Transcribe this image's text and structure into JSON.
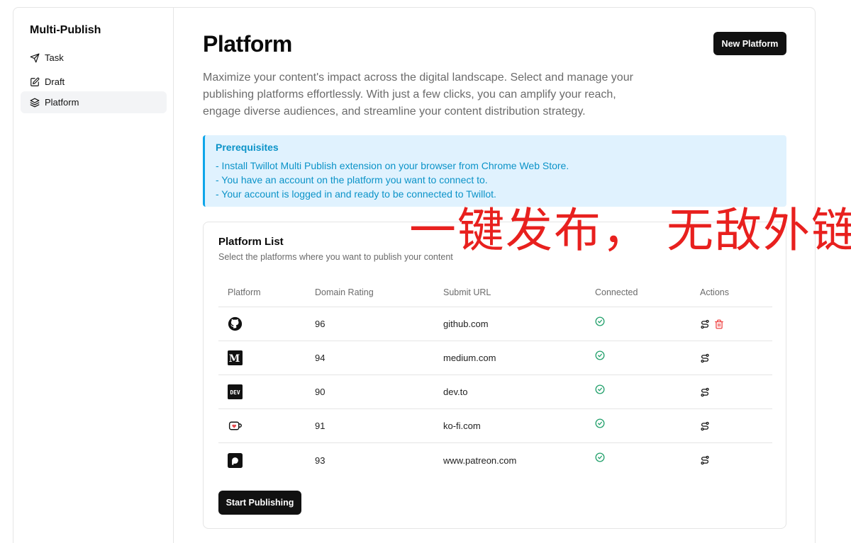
{
  "sidebar": {
    "app_title": "Multi-Publish",
    "items": [
      {
        "label": "Task",
        "icon": "send-icon"
      },
      {
        "label": "Draft",
        "icon": "edit-icon"
      },
      {
        "label": "Platform",
        "icon": "layers-icon",
        "active": true
      }
    ]
  },
  "header": {
    "title": "Platform",
    "new_button": "New Platform",
    "description": "Maximize your content's impact across the digital landscape. Select and manage your publishing platforms effortlessly. With just a few clicks, you can amplify your reach, engage diverse audiences, and streamline your content distribution strategy."
  },
  "prerequisites": {
    "title": "Prerequisites",
    "items": [
      "- Install Twillot Multi Publish extension on your browser from Chrome Web Store.",
      "- You have an account on the platform you want to connect to.",
      "- Your account is logged in and ready to be connected to Twillot."
    ]
  },
  "platform_list": {
    "title": "Platform List",
    "subtitle": "Select the platforms where you want to publish your content",
    "columns": [
      "Platform",
      "Domain Rating",
      "Submit URL",
      "Connected",
      "Actions"
    ],
    "rows": [
      {
        "icon": "github-icon",
        "rating": "96",
        "url": "github.com",
        "connected": true,
        "deletable": true
      },
      {
        "icon": "medium-icon",
        "rating": "94",
        "url": "medium.com",
        "connected": true,
        "deletable": false
      },
      {
        "icon": "dev-icon",
        "rating": "90",
        "url": "dev.to",
        "connected": true,
        "deletable": false
      },
      {
        "icon": "kofi-icon",
        "rating": "91",
        "url": "ko-fi.com",
        "connected": true,
        "deletable": false
      },
      {
        "icon": "patreon-icon",
        "rating": "93",
        "url": "www.patreon.com",
        "connected": true,
        "deletable": false
      }
    ],
    "start_button": "Start Publishing"
  },
  "overlay": {
    "text": "一键发布， 无敌外链"
  },
  "colors": {
    "accent": "#111111",
    "info_bg": "#e0f2fe",
    "info_text": "#0b93c8",
    "success": "#22a06b",
    "danger": "#ef4444",
    "overlay": "#e8201e"
  }
}
